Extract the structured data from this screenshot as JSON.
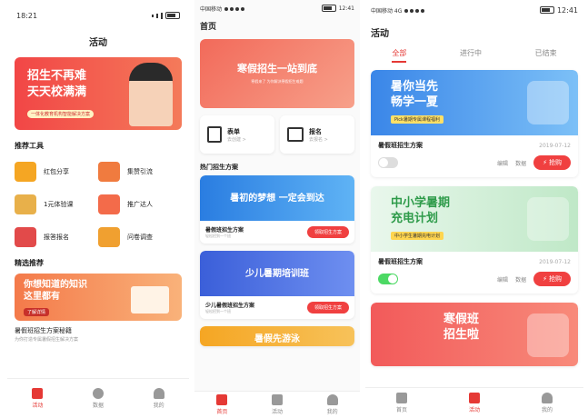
{
  "p1": {
    "time": "18:21",
    "title": "活动",
    "banner": {
      "line1": "招生不再难",
      "line2": "天天校满满",
      "sub": "一体化教育机构智能解决方案"
    },
    "tools_header": "推荐工具",
    "tools": [
      {
        "label": "红包分享",
        "icon": "red-envelope-icon",
        "color": "#f5a623"
      },
      {
        "label": "集赞引流",
        "icon": "like-icon",
        "color": "#f07b3f"
      },
      {
        "label": "1元体验课",
        "icon": "coin-icon",
        "color": "#e8b04a"
      },
      {
        "label": "推广达人",
        "icon": "megaphone-icon",
        "color": "#f36b4a"
      },
      {
        "label": "报答报名",
        "icon": "form-icon",
        "color": "#e24a4a"
      },
      {
        "label": "问卷调查",
        "icon": "survey-icon",
        "color": "#f0a030"
      }
    ],
    "featured_header": "精选推荐",
    "featured_banner": {
      "line1": "你想知道的知识",
      "line2": "这里都有",
      "btn": "了解详情"
    },
    "article_title": "暑假班招生方案秘籍",
    "article_sub": "为你打造专属暑假招生解决方案",
    "tabs": [
      {
        "label": "活动"
      },
      {
        "label": "数据"
      },
      {
        "label": "我的"
      }
    ]
  },
  "p2": {
    "carrier": "中国移动",
    "time": "12:41",
    "title": "首页",
    "banner": {
      "line1": "寒假招生一站到底",
      "sub": "寒假来了 为你解决寒假招生难题"
    },
    "quick": [
      {
        "label": "表单",
        "sub": "去创建 >",
        "icon": "form-icon"
      },
      {
        "label": "报名",
        "sub": "去报名 >",
        "icon": "signup-icon"
      }
    ],
    "hot_header": "热门招生方案",
    "plans": [
      {
        "banner": "暑初的梦想 一定会到达",
        "title": "暑假班招生方案",
        "sub": "轻松招到一个班",
        "btn": "领取招生方案",
        "color1": "#2a7de1",
        "color2": "#5fb3f5"
      },
      {
        "banner": "少儿暑期培训班",
        "title": "少儿暑假班招生方案",
        "sub": "轻松招到一个班",
        "btn": "领取招生方案",
        "color1": "#3b5fd9",
        "color2": "#6e8ff0"
      },
      {
        "banner": "暑假先游泳",
        "title": "",
        "sub": "",
        "btn": "",
        "color1": "#f5a623",
        "color2": "#f7c25a"
      }
    ],
    "tabs": [
      {
        "label": "首页"
      },
      {
        "label": "活动"
      },
      {
        "label": "我的"
      }
    ]
  },
  "p3": {
    "carrier": "中国移动 4G",
    "time": "12:41",
    "title": "活动",
    "filters": [
      "全部",
      "进行中",
      "已结束"
    ],
    "activities": [
      {
        "line1": "暑你当先",
        "line2": "畅学一夏",
        "tag": "Pick暑期专属课程福利",
        "title": "暑假班招生方案",
        "date": "2019-07-12",
        "edit": "编辑",
        "data": "数据",
        "buy": "抢购",
        "enabled": false,
        "color1": "#3a86e8",
        "color2": "#7cc0f7"
      },
      {
        "line1": "中小学暑期",
        "line2": "充电计划",
        "tag": "中小学生暑期充电计划",
        "title": "暑假班招生方案",
        "date": "2019-07-12",
        "edit": "编辑",
        "data": "数据",
        "buy": "抢购",
        "enabled": true,
        "color1": "#e9f7ec",
        "color2": "#bfe8c7"
      },
      {
        "line1": "寒假班",
        "line2": "招生啦",
        "tag": "",
        "title": "",
        "date": "",
        "edit": "",
        "data": "",
        "buy": "",
        "enabled": false,
        "color1": "#f25a5a",
        "color2": "#f88a7a"
      }
    ],
    "tabs": [
      {
        "label": "首页"
      },
      {
        "label": "活动"
      },
      {
        "label": "我的"
      }
    ]
  }
}
